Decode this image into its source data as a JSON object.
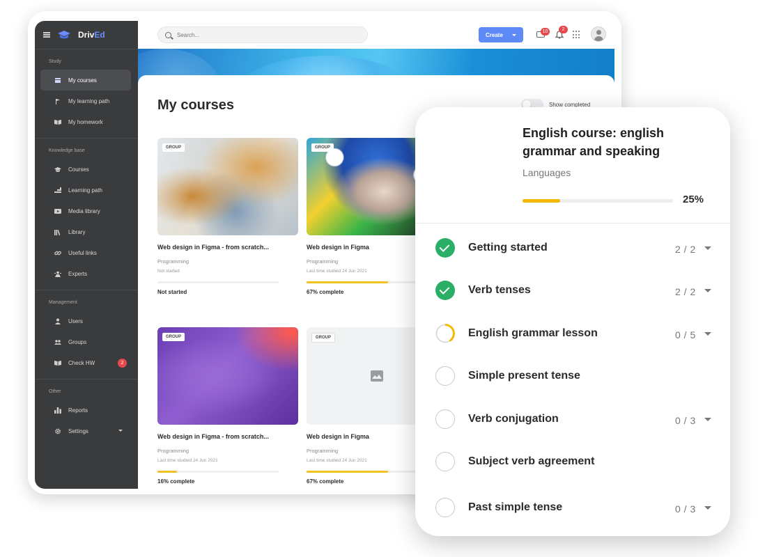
{
  "app": {
    "logo": {
      "brand_a": "Driv",
      "brand_b": "Ed"
    },
    "search": {
      "placeholder": "Search..."
    },
    "create_label": "Create",
    "mail_badge": "10",
    "bell_badge": "2",
    "colors": {
      "sidebar": "#3a3b3d",
      "accent": "#5e8af7",
      "progress": "#f4c021",
      "badge": "#e5484d",
      "done": "#2bae66"
    }
  },
  "sidebar": {
    "sections": [
      {
        "heading": "Study",
        "items": [
          {
            "label": "My courses",
            "icon": "courses-icon",
            "active": true
          },
          {
            "label": "My learning path",
            "icon": "flag-icon"
          },
          {
            "label": "My homework",
            "icon": "book-icon"
          }
        ]
      },
      {
        "heading": "Knowledge base",
        "items": [
          {
            "label": "Courses",
            "icon": "graduation-cap-icon"
          },
          {
            "label": "Learning path",
            "icon": "path-icon"
          },
          {
            "label": "Media library",
            "icon": "play-icon"
          },
          {
            "label": "Library",
            "icon": "books-icon"
          },
          {
            "label": "Useful links",
            "icon": "link-icon"
          },
          {
            "label": "Experts",
            "icon": "expert-icon"
          }
        ]
      },
      {
        "heading": "Management",
        "items": [
          {
            "label": "Users",
            "icon": "user-icon"
          },
          {
            "label": "Groups",
            "icon": "group-icon"
          },
          {
            "label": "Check HW",
            "icon": "book-icon",
            "badge": "2"
          }
        ]
      },
      {
        "heading": "Other",
        "items": [
          {
            "label": "Reports",
            "icon": "bar-chart-icon"
          },
          {
            "label": "Settings",
            "icon": "gear-icon"
          }
        ]
      }
    ]
  },
  "main": {
    "title": "My courses",
    "show_completed": "Show completed",
    "cards": [
      {
        "tag": "GROUP",
        "title": "Web design in Figma - from scratch...",
        "category": "Programming",
        "meta": "Not started",
        "progress": 0,
        "status": "Not started"
      },
      {
        "tag": "GROUP",
        "title": "Web design in Figma",
        "category": "Programming",
        "meta": "Last time studied 24 Jun 2021",
        "progress": 0.67,
        "status": "67% complete"
      },
      {
        "tag": "GROUP",
        "title": "Web design in Figma - from scratch...",
        "category": "Programming",
        "meta": "Last time studied 24 Jun 2021",
        "progress": 0.16,
        "status": "16% complete"
      },
      {
        "tag": "GROUP",
        "title": "Web design in Figma",
        "category": "Programming",
        "meta": "Last time studied 24 Jun 2021",
        "progress": 0.67,
        "status": "67% complete"
      }
    ]
  },
  "course_panel": {
    "title": "English course: english grammar and speaking",
    "subtitle": "Languages",
    "progress": 0.25,
    "progress_label": "25%",
    "lessons": [
      {
        "name": "Getting started",
        "state": "done",
        "count": "2 / 2",
        "expandable": true
      },
      {
        "name": "Verb tenses",
        "state": "done",
        "count": "2 / 2",
        "expandable": true
      },
      {
        "name": "English grammar lesson",
        "state": "partial",
        "count": "0 / 5",
        "expandable": true
      },
      {
        "name": "Simple present tense",
        "state": "empty",
        "count": "",
        "expandable": false
      },
      {
        "name": "Verb conjugation",
        "state": "empty",
        "count": "0 / 3",
        "expandable": true
      },
      {
        "name": "Subject verb agreement",
        "state": "empty",
        "count": "",
        "expandable": false
      },
      {
        "name": "Past simple tense",
        "state": "empty",
        "count": "0 / 3",
        "expandable": true
      }
    ]
  }
}
